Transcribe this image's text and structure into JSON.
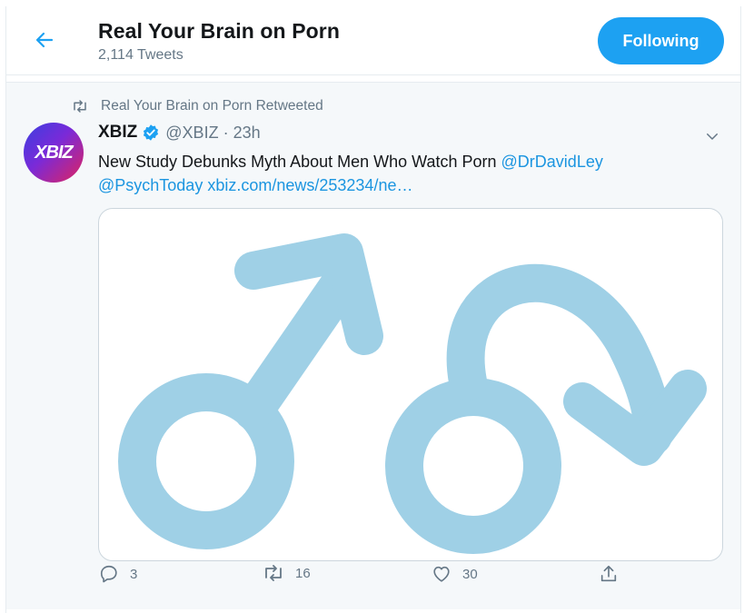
{
  "header": {
    "title": "Real Your Brain on Porn",
    "tweet_count": "2,114 Tweets",
    "follow_label": "Following"
  },
  "tweet": {
    "retweet_label": "Real Your Brain on Porn Retweeted",
    "avatar_text": "XBIZ",
    "author_name": "XBIZ",
    "handle": "@XBIZ",
    "separator": "·",
    "time": "23h",
    "text_plain": "New Study Debunks Myth About Men Who Watch Porn ",
    "mention_1": "@DrDavidLey",
    "mention_2": "@PsychToday",
    "url": "xbiz.com/news/253234/ne…",
    "replies": "3",
    "retweets": "16",
    "likes": "30"
  },
  "colors": {
    "accent": "#1da1f2",
    "link": "#1b95e0",
    "muted": "#657786",
    "symbol": "#9fd0e6"
  },
  "icons": {
    "back": "arrow-left-icon",
    "retweet": "retweet-icon",
    "verified": "verified-badge-icon",
    "caret": "chevron-down-icon",
    "reply": "reply-icon",
    "like": "heart-icon",
    "share": "share-icon"
  }
}
